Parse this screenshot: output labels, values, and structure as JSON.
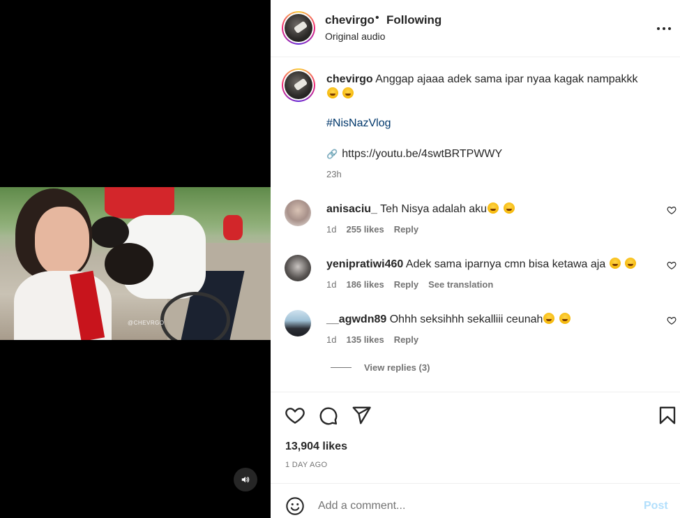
{
  "media": {
    "watermark": "@CHEVRGO",
    "mute_icon": "speaker-icon"
  },
  "header": {
    "username": "chevirgo",
    "separator": "•",
    "follow_label": "Following",
    "subtitle": "Original audio",
    "more_icon": "more-options-icon"
  },
  "caption": {
    "username": "chevirgo",
    "text": "Anggap ajaaa adek sama ipar nyaa kagak nampakkk",
    "emojis": [
      "smiling-face-with-heart-eyes-emoji",
      "rolling-on-floor-laughing-emoji"
    ],
    "hashtag": "#NisNazVlog",
    "link": "https://youtu.be/4swtBRTPWWY",
    "time": "23h"
  },
  "comments": [
    {
      "username": "anisaciu_",
      "text": "Teh Nisya adalah aku",
      "emojis": [
        "face-with-tears-of-joy-emoji",
        "smiling-face-with-heart-eyes-emoji"
      ],
      "age": "1d",
      "likes": "255 likes",
      "reply": "Reply"
    },
    {
      "username": "yenipratiwi460",
      "text": "Adek sama iparnya cmn bisa ketawa aja",
      "emojis": [
        "face-with-tears-of-joy-emoji",
        "face-with-tears-of-joy-emoji"
      ],
      "age": "1d",
      "likes": "186 likes",
      "reply": "Reply",
      "translate": "See translation"
    },
    {
      "username": "__agwdn89",
      "text": "Ohhh seksihhh sekalliii ceunah",
      "emojis": [
        "face-with-tears-of-joy-emoji",
        "smiling-face-with-heart-eyes-emoji"
      ],
      "age": "1d",
      "likes": "135 likes",
      "reply": "Reply"
    }
  ],
  "view_replies": "View replies (3)",
  "actions": {
    "likes": "13,904 likes",
    "date": "1 DAY AGO"
  },
  "add_comment": {
    "placeholder": "Add a comment...",
    "post_label": "Post"
  },
  "colors": {
    "link": "#00376b",
    "secondary_text": "#737373",
    "post_disabled": "#b2dffc"
  }
}
